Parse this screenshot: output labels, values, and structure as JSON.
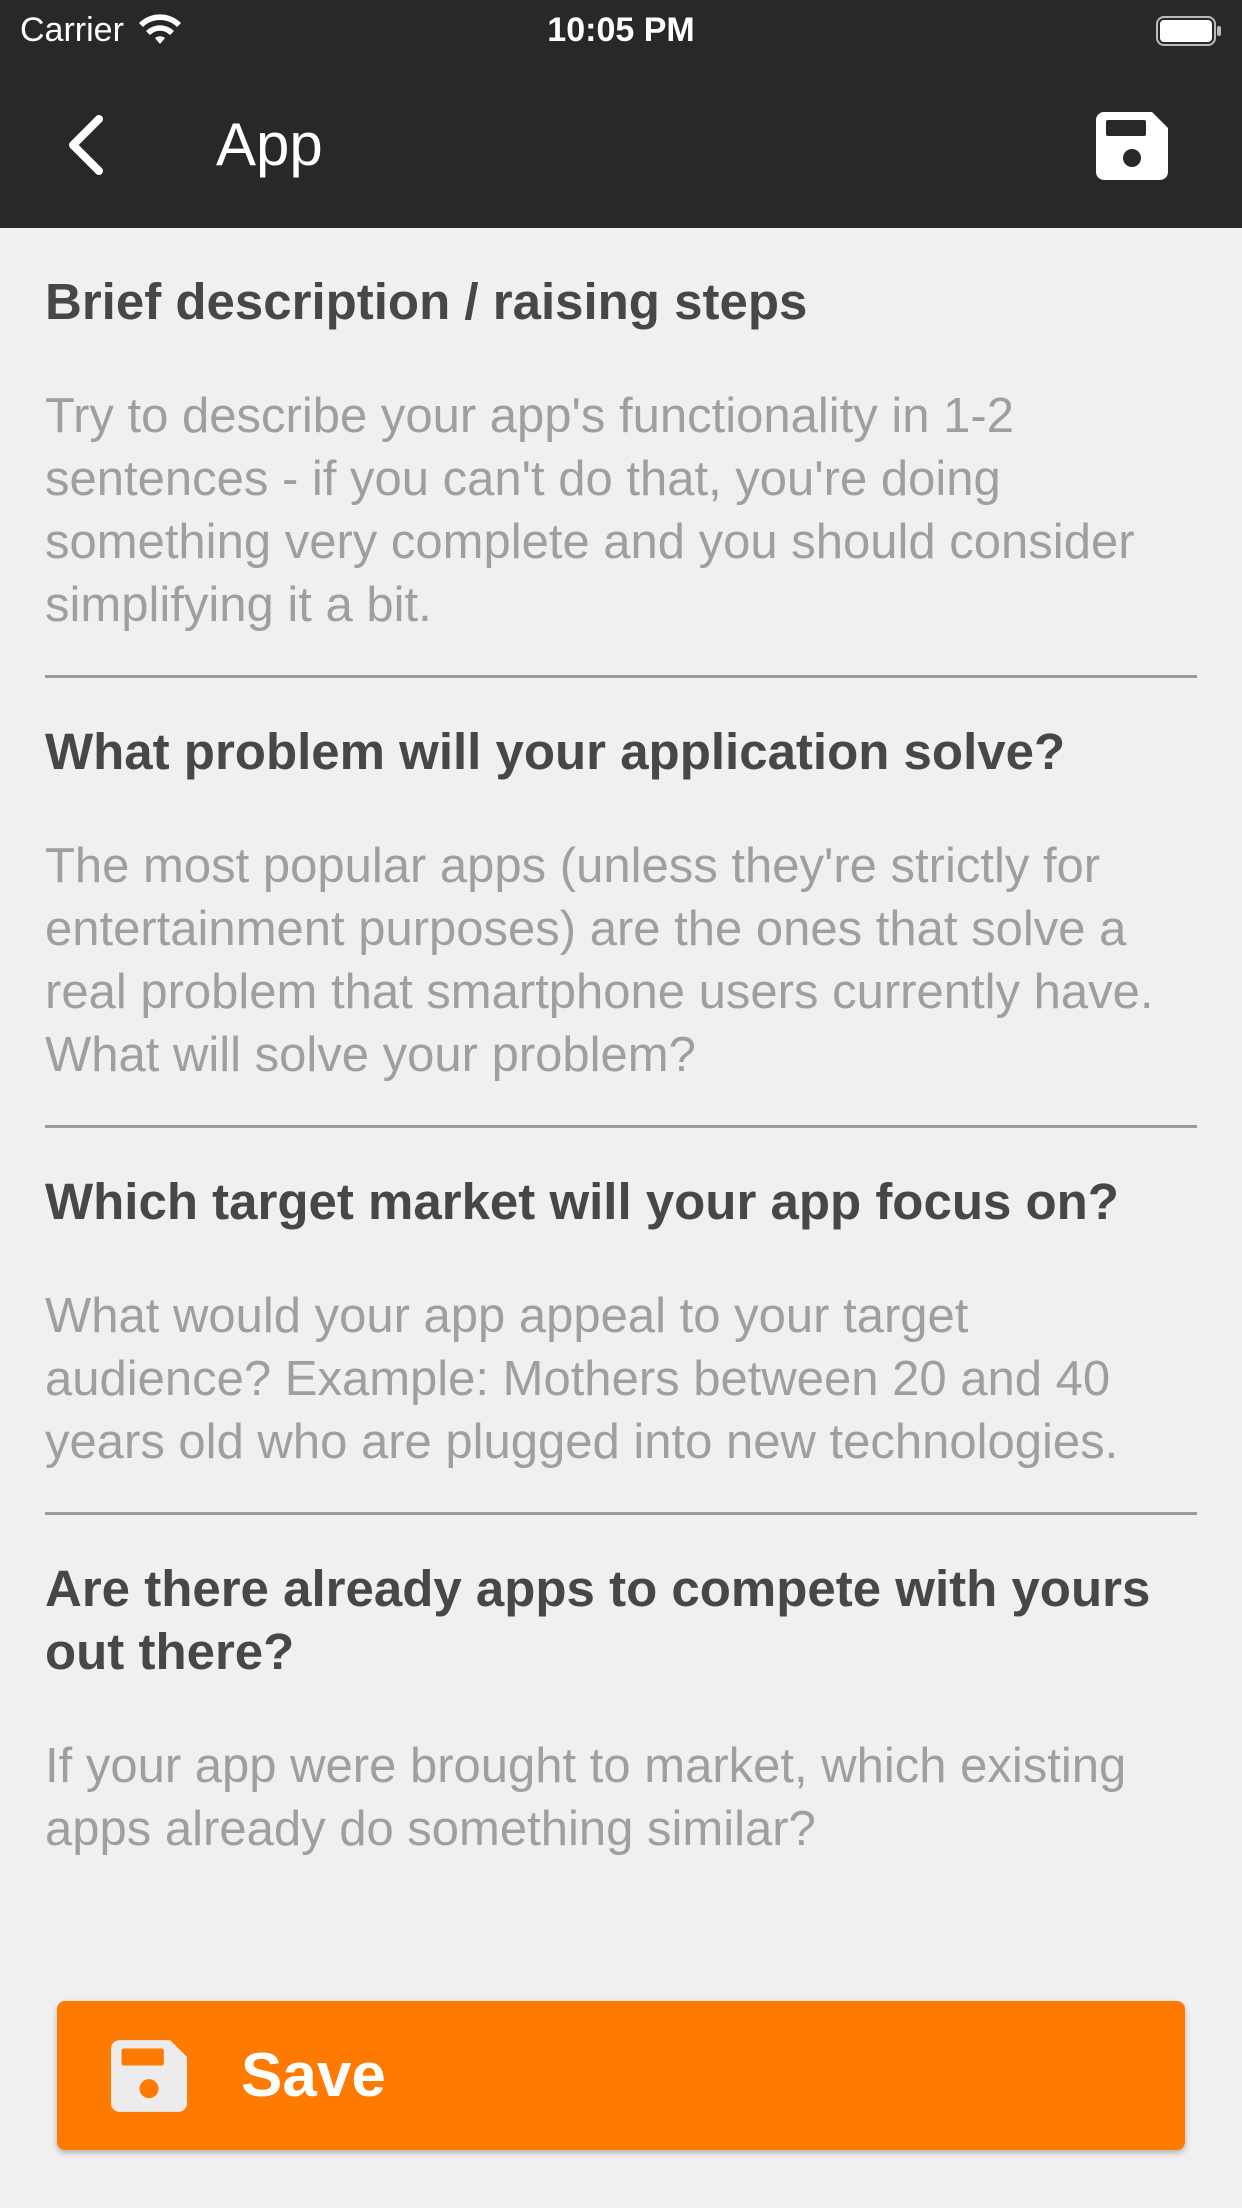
{
  "status_bar": {
    "carrier": "Carrier",
    "time": "10:05 PM",
    "icons": [
      "wifi-icon",
      "battery-icon"
    ]
  },
  "header": {
    "title": "App",
    "back_icon": "chevron-left-icon",
    "save_icon": "floppy-disk-icon"
  },
  "sections": [
    {
      "title": "Brief description / raising steps",
      "placeholder": "Try to describe your app's functionality in 1-2 sentences - if you can't do that, you're doing something very complete and you should consider simplifying it a bit."
    },
    {
      "title": "What problem will your application solve?",
      "placeholder": "The most popular apps (unless they're strictly for entertainment purposes) are the ones that solve a real problem that smartphone users currently have. What will solve your problem?"
    },
    {
      "title": "Which target market will your app focus on?",
      "placeholder": "What would your app appeal to your target audience? Example: Mothers between 20 and 40 years old who are plugged into new technologies."
    },
    {
      "title": "Are there already apps to compete with yours out there?",
      "placeholder": "If your app were brought to market, which existing apps already do something similar?"
    }
  ],
  "save_button": {
    "label": "Save",
    "icon": "floppy-disk-icon"
  },
  "colors": {
    "nav_background": "#282828",
    "accent": "#fe7a00",
    "title_text": "#474747",
    "placeholder_text": "#9f9f9f",
    "background": "#f0f0f0"
  }
}
